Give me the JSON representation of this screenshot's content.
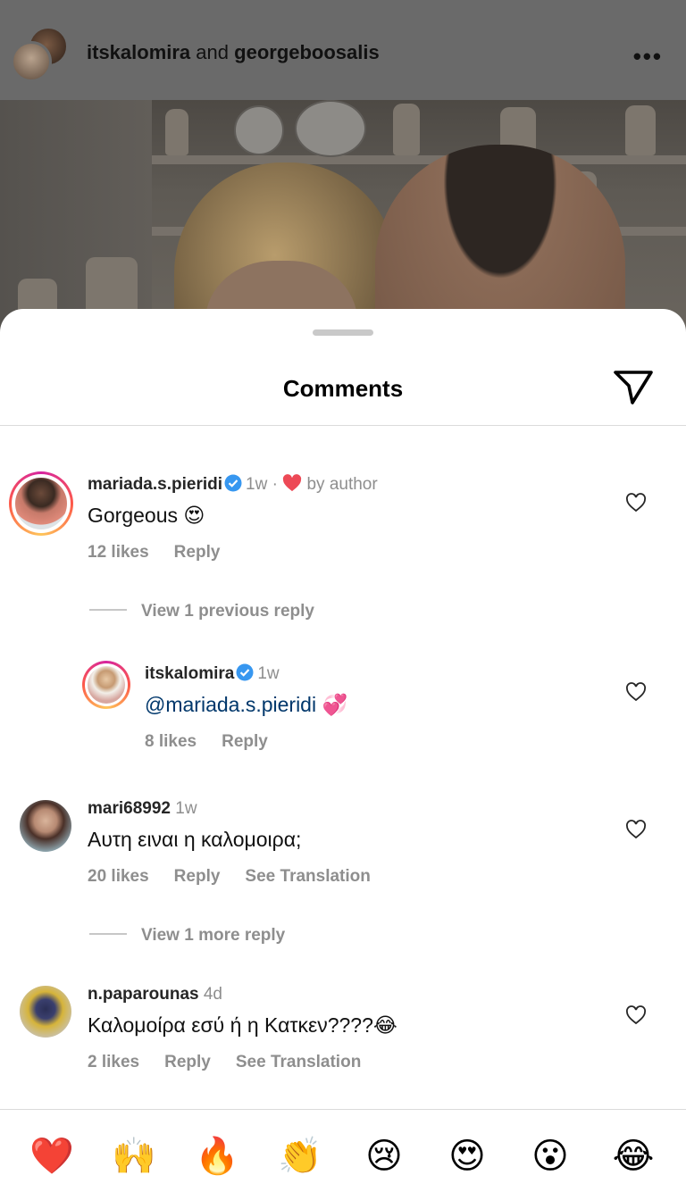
{
  "post_header": {
    "user1": "itskalomira",
    "joiner": "and",
    "user2": "georgeboosalis",
    "more_icon": "more-horizontal-icon"
  },
  "sheet": {
    "title": "Comments",
    "share_icon": "paper-plane-icon"
  },
  "comments": [
    {
      "username": "mariada.s.pieridi",
      "verified": true,
      "time": "1w",
      "liked_by_author": "by author",
      "text": "Gorgeous 😍",
      "likes": "12 likes",
      "reply": "Reply",
      "view_replies": "View 1 previous reply"
    },
    {
      "username": "itskalomira",
      "verified": true,
      "time": "1w",
      "mention": "@mariada.s.pieridi",
      "text_after": "💞",
      "likes": "8 likes",
      "reply": "Reply"
    },
    {
      "username": "mari68992",
      "time": "1w",
      "text": "Αυτη ειναι η καλομοιρα;",
      "likes": "20 likes",
      "reply": "Reply",
      "translate": "See Translation",
      "view_replies": "View 1 more reply"
    },
    {
      "username": "n.paparounas",
      "time": "4d",
      "text": "Καλομοίρα εσύ ή η Κατκεν????😂",
      "likes": "2 likes",
      "reply": "Reply",
      "translate": "See Translation"
    }
  ],
  "quick_reactions": [
    "❤️",
    "🙌",
    "🔥",
    "👏",
    "😢",
    "😍",
    "😮",
    "😂"
  ],
  "colors": {
    "verified": "#3797f0",
    "heart": "#ed4956",
    "mention": "#00376b",
    "muted": "#8e8e8e"
  }
}
